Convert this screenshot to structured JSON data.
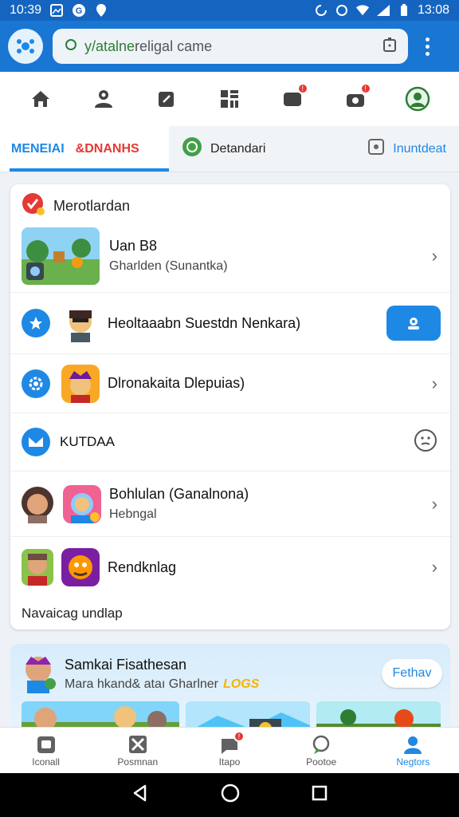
{
  "status_bar": {
    "time_left": "10:39",
    "time_right": "13:08"
  },
  "url_bar": {
    "prefix": "y/atalne",
    "rest": "religal came"
  },
  "tabs": {
    "tab1_blue": "MENEIAI",
    "tab1_red": "&DNANHS",
    "tab2_label": "Detandari",
    "tab3_label": "Inuntdeat"
  },
  "card": {
    "header": "Merotlardan",
    "rows": [
      {
        "title": "Uan B8",
        "subtitle": "Gharlden (Sunantka)"
      },
      {
        "title": "Heoltaaabn Suestdn Nenkara)"
      },
      {
        "title": "Dlronakaita Dlepuias)"
      },
      {
        "title": "KUTDAA"
      },
      {
        "title": "Bohlulan (Ganalnona)",
        "subtitle": "Hebngal"
      },
      {
        "title": "Rendknlag"
      }
    ],
    "footer": "Navaicag undlap"
  },
  "promo": {
    "title": "Samkai Fisathesan",
    "subtitle": "Mara hkand& ataı Gharlner",
    "badge": "LOGS",
    "button": "Fethav"
  },
  "bottom_nav": [
    {
      "label": "Iconall",
      "icon": "game-icon"
    },
    {
      "label": "Posmnan",
      "icon": "tools-icon"
    },
    {
      "label": "Itapo",
      "icon": "message-icon"
    },
    {
      "label": "Pootoe",
      "icon": "comment-icon"
    },
    {
      "label": "Negtors",
      "icon": "profile-icon"
    }
  ],
  "colors": {
    "accent": "#1e88e5",
    "app_bar": "#1976d2",
    "alert": "#e53935",
    "green": "#2e7d32"
  }
}
